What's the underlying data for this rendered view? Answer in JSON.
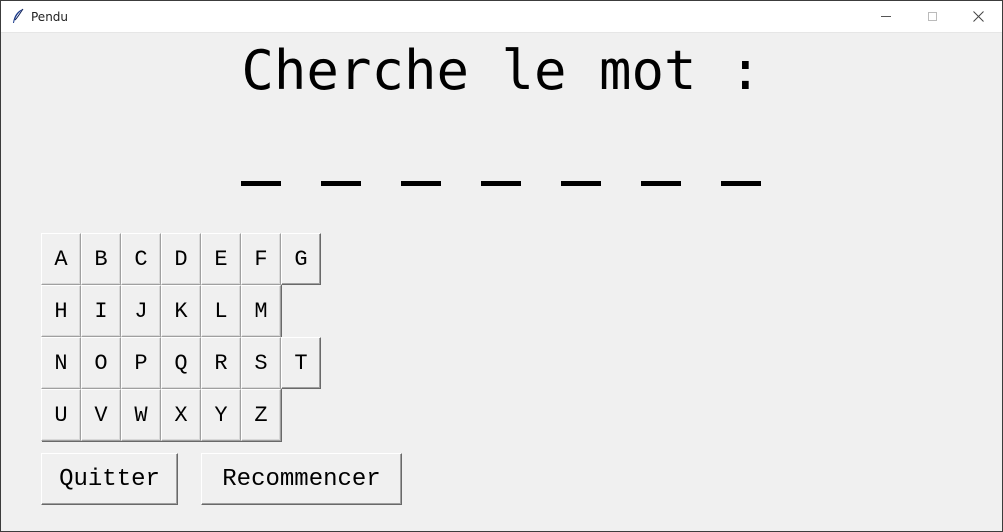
{
  "window": {
    "title": "Pendu",
    "icon": "feather-icon"
  },
  "heading": "Cherche le mot :",
  "word": {
    "letter_count": 7,
    "revealed": [
      "",
      "",
      "",
      "",
      "",
      "",
      ""
    ]
  },
  "keyboard": {
    "rows": [
      [
        "A",
        "B",
        "C",
        "D",
        "E",
        "F",
        "G"
      ],
      [
        "H",
        "I",
        "J",
        "K",
        "L",
        "M"
      ],
      [
        "N",
        "O",
        "P",
        "Q",
        "R",
        "S",
        "T"
      ],
      [
        "U",
        "V",
        "W",
        "X",
        "Y",
        "Z"
      ]
    ]
  },
  "actions": {
    "quit_label": "Quitter",
    "restart_label": "Recommencer"
  }
}
